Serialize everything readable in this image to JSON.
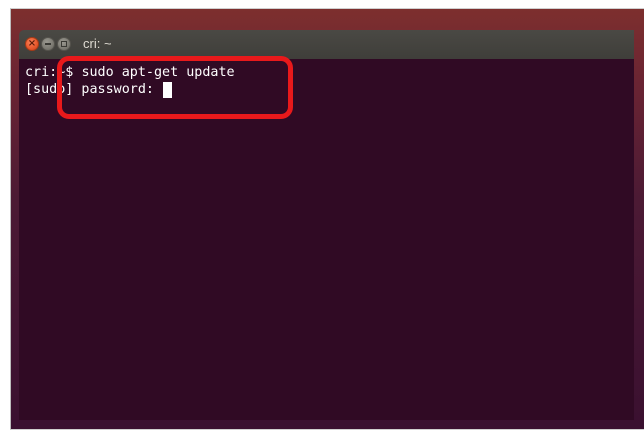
{
  "window": {
    "title": "cri: ~"
  },
  "titlebar_buttons": {
    "close_glyph": "×",
    "close_icon": "close-icon",
    "minimize_icon": "minimize-icon",
    "maximize_icon": "maximize-icon"
  },
  "terminal": {
    "prompt": "cri:~$ ",
    "command": "sudo apt-get update",
    "password_prompt": "[sudo] password: ",
    "background_color": "#300a24",
    "text_color": "#ffffff"
  },
  "annotation": {
    "color": "#e8191b"
  }
}
